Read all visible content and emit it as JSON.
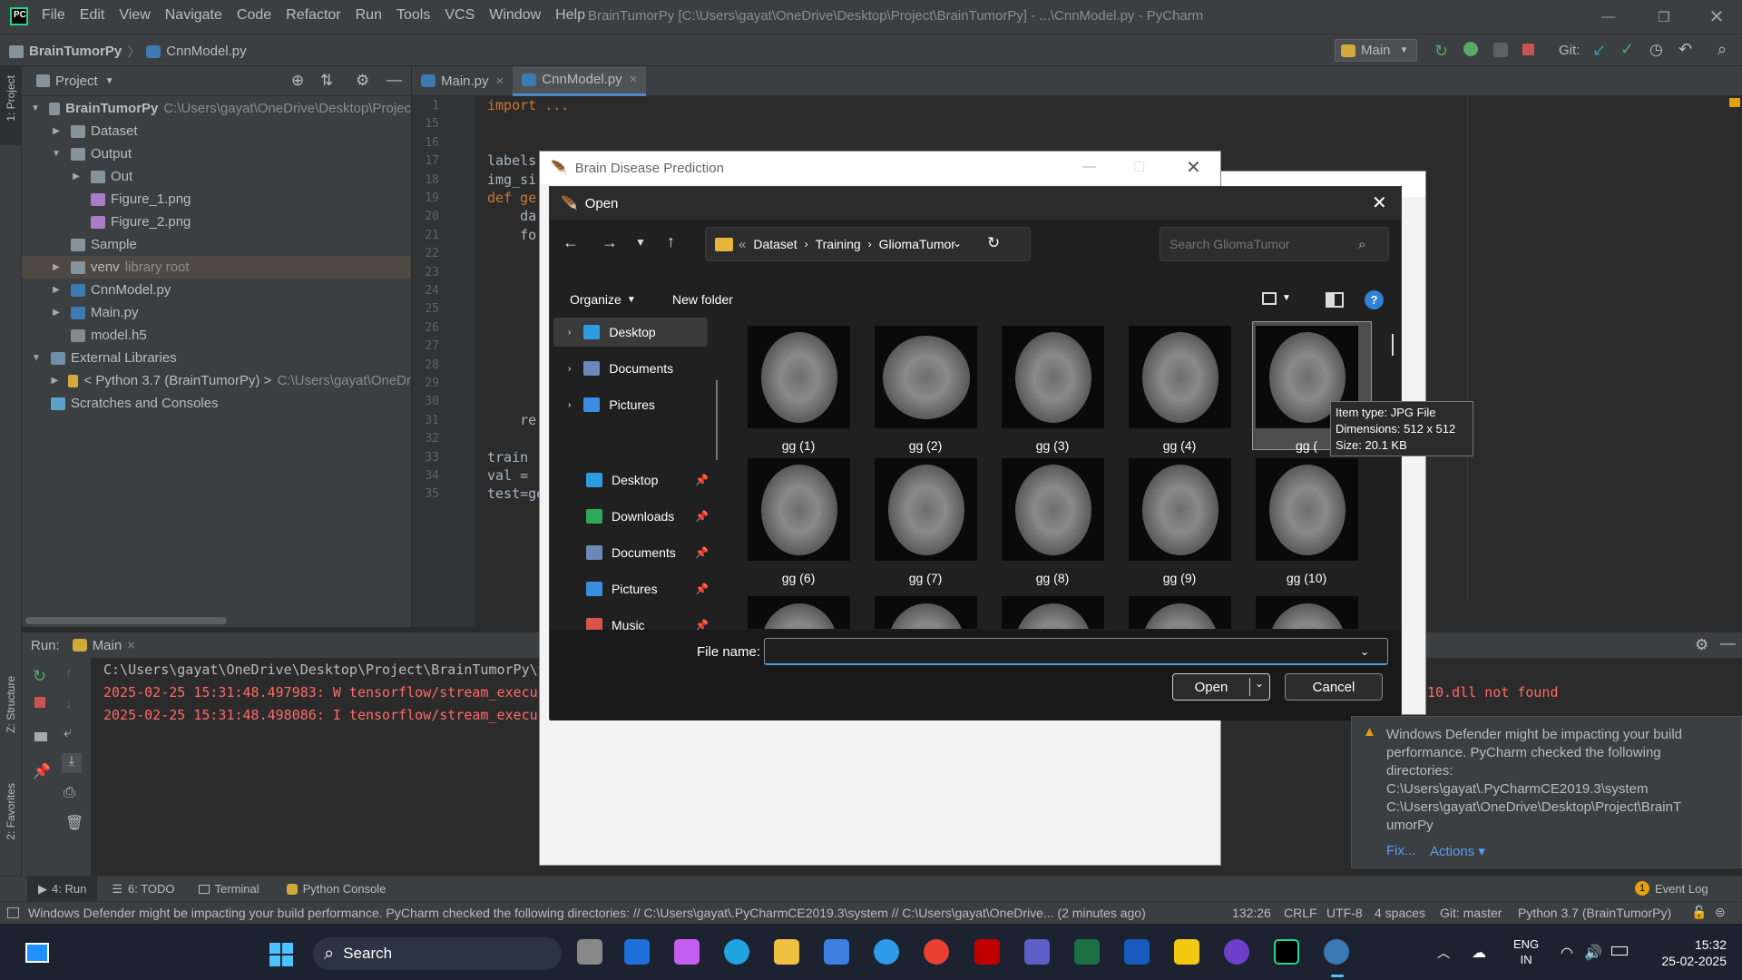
{
  "app": {
    "title": "BrainTumorPy [C:\\Users\\gayat\\OneDrive\\Desktop\\Project\\BrainTumorPy] - ...\\CnnModel.py - PyCharm",
    "menu": [
      "File",
      "Edit",
      "View",
      "Navigate",
      "Code",
      "Refactor",
      "Run",
      "Tools",
      "VCS",
      "Window",
      "Help"
    ]
  },
  "navbar": {
    "project": "BrainTumorPy",
    "file": "CnnModel.py",
    "run_config": "Main",
    "git_label": "Git:"
  },
  "side_tabs": {
    "project": "1: Project",
    "structure": "Z: Structure",
    "favorites": "2: Favorites"
  },
  "project": {
    "header": "Project",
    "items": [
      {
        "label": "BrainTumorPy",
        "extra": "C:\\Users\\gayat\\OneDrive\\Desktop\\Projec"
      },
      {
        "label": "Dataset"
      },
      {
        "label": "Output"
      },
      {
        "label": "Out"
      },
      {
        "label": "Figure_1.png"
      },
      {
        "label": "Figure_2.png"
      },
      {
        "label": "Sample"
      },
      {
        "label": "venv",
        "extra": "library root"
      },
      {
        "label": "CnnModel.py"
      },
      {
        "label": "Main.py"
      },
      {
        "label": "model.h5"
      },
      {
        "label": "External Libraries"
      },
      {
        "label": "< Python 3.7 (BrainTumorPy) >",
        "extra": "C:\\Users\\gayat\\OneDr"
      },
      {
        "label": "Scratches and Consoles"
      }
    ]
  },
  "editor": {
    "tabs": [
      "Main.py",
      "CnnModel.py"
    ],
    "lines": [
      "1",
      "15",
      "16",
      "17",
      "18",
      "19",
      "20",
      "21",
      "22",
      "23",
      "24",
      "25",
      "26",
      "27",
      "28",
      "29",
      "30",
      "31",
      "32",
      "33",
      "34",
      "35"
    ],
    "code": [
      "import ...",
      "",
      "",
      "labels",
      "img_si",
      "def ge",
      "    da",
      "    fo",
      "",
      "",
      "",
      "",
      "",
      "",
      "",
      "",
      "",
      "    re",
      "",
      "train",
      "val = ",
      "test=ge"
    ]
  },
  "run": {
    "label": "Run:",
    "config": "Main",
    "output": [
      "C:\\Users\\gayat\\OneDrive\\Desktop\\Project\\BrainTumorPy\\v",
      "2025-02-25 15:31:48.497983: W tensorflow/stream_execu",
      "2025-02-25 15:31:48.498086: I tensorflow/stream_execu"
    ],
    "right_text": "10.dll not found"
  },
  "toolwindows": [
    "4: Run",
    "6: TODO",
    "Terminal",
    "Python Console",
    "Event Log"
  ],
  "statusbar": {
    "message": "Windows Defender might be impacting your build performance. PyCharm checked the following directories: // C:\\Users\\gayat\\.PyCharmCE2019.3\\system // C:\\Users\\gayat\\OneDrive... (2 minutes ago)",
    "position": "132:26",
    "line_sep": "CRLF",
    "encoding": "UTF-8",
    "indent": "4 spaces",
    "git": "Git: master",
    "interpreter": "Python 3.7 (BrainTumorPy)"
  },
  "notification": {
    "text": "Windows Defender might be impacting your build performance. PyCharm checked the following directories:",
    "paths": [
      "C:\\Users\\gayat\\.PyCharmCE2019.3\\system",
      "C:\\Users\\gayat\\OneDrive\\Desktop\\Project\\BrainT",
      "umorPy"
    ],
    "fix": "Fix...",
    "actions": "Actions ▾"
  },
  "tkwindow": {
    "title": "Brain Disease Prediction"
  },
  "dialog": {
    "title": "Open",
    "path": [
      "Dataset",
      "Training",
      "GliomaTumor"
    ],
    "search_placeholder": "Search GliomaTumor",
    "organize": "Organize",
    "new_folder": "New folder",
    "nav_top": [
      "Desktop",
      "Documents",
      "Pictures"
    ],
    "nav_quick": [
      "Desktop",
      "Downloads",
      "Documents",
      "Pictures",
      "Music"
    ],
    "files": [
      "gg (1)",
      "gg (2)",
      "gg (3)",
      "gg (4)",
      "gg (",
      "gg (6)",
      "gg (7)",
      "gg (8)",
      "gg (9)",
      "gg (10)"
    ],
    "file_name_label": "File name:",
    "file_name_value": "",
    "open_btn": "Open",
    "cancel_btn": "Cancel",
    "tooltip": [
      "Item type: JPG File",
      "Dimensions: 512 x 512",
      "Size: 20.1 KB"
    ]
  },
  "taskbar": {
    "search": "Search",
    "lang": "ENG",
    "region": "IN",
    "time": "15:32",
    "date": "25-02-2025"
  }
}
